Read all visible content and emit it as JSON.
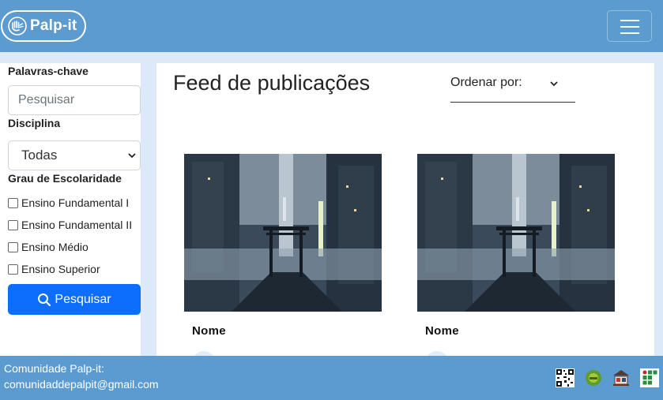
{
  "brand": {
    "name": "Palp-it"
  },
  "sidebar": {
    "keywords_label": "Palavras-chave",
    "search_placeholder": "Pesquisar",
    "discipline_label": "Disciplina",
    "discipline_value": "Todas",
    "level_label": "Grau de Escolaridade",
    "levels": [
      {
        "label": "Ensino Fundamental I",
        "checked": false
      },
      {
        "label": "Ensino Fundamental II",
        "checked": false
      },
      {
        "label": "Ensino Médio",
        "checked": false
      },
      {
        "label": "Ensino Superior",
        "checked": false
      }
    ],
    "search_button": "Pesquisar"
  },
  "feed": {
    "title": "Feed de publicações",
    "order_label": "Ordenar por:",
    "posts": [
      {
        "name": "Nome"
      },
      {
        "name": "Nome"
      }
    ]
  },
  "footer": {
    "line1": "Comunidade Palp-it:",
    "line2": "comunidaddepalpit@gmail.com",
    "icons": [
      "qr-code-icon",
      "green-seal-icon",
      "library-icon",
      "institute-logo-icon"
    ]
  },
  "colors": {
    "navbar": "#5b9bd0",
    "background": "#dbe9f8",
    "primary_button": "#0d6efd"
  }
}
